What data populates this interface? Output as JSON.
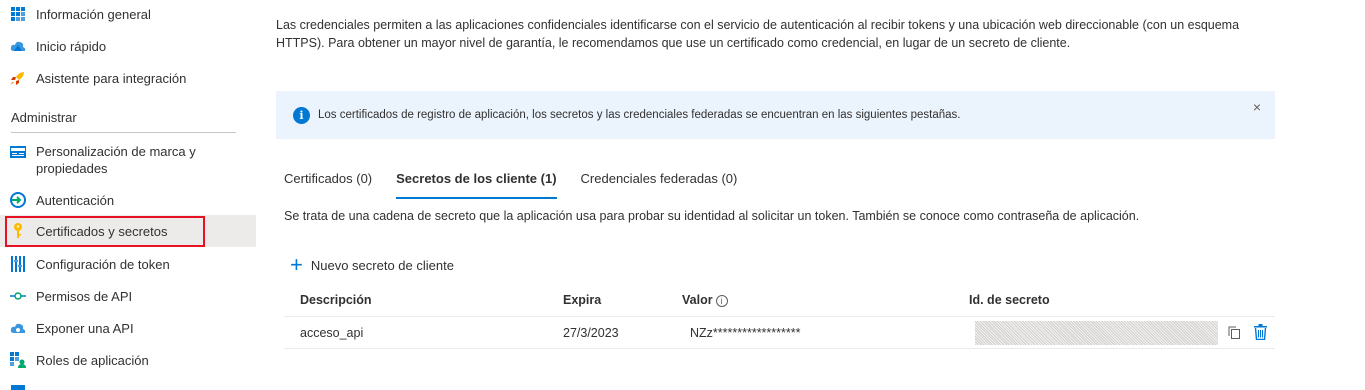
{
  "sidebar": {
    "items_top": [
      {
        "label": "Información general"
      },
      {
        "label": "Inicio rápido"
      },
      {
        "label": "Asistente para integración"
      }
    ],
    "section_title": "Administrar",
    "items_manage": [
      {
        "label": "Personalización de marca y propiedades"
      },
      {
        "label": "Autenticación"
      },
      {
        "label": "Certificados y secretos"
      },
      {
        "label": "Configuración de token"
      },
      {
        "label": "Permisos de API"
      },
      {
        "label": "Exponer una API"
      },
      {
        "label": "Roles de aplicación"
      }
    ]
  },
  "main": {
    "intro": "Las credenciales permiten a las aplicaciones confidenciales identificarse con el servicio de autenticación al recibir tokens y una ubicación web direccionable (con un esquema HTTPS). Para obtener un mayor nivel de garantía, le recomendamos que use un certificado como credencial, en lugar de un secreto de cliente.",
    "banner": {
      "text": "Los certificados de registro de aplicación, los secretos y las credenciales federadas se encuentran en las siguientes pestañas.",
      "close": "×"
    },
    "tabs": [
      {
        "label": "Certificados (0)"
      },
      {
        "label": "Secretos de los cliente (1)"
      },
      {
        "label": "Credenciales federadas (0)"
      }
    ],
    "tab_description": "Se trata de una cadena de secreto que la aplicación usa para probar su identidad al solicitar un token. También se conoce como contraseña de aplicación.",
    "new_secret_label": "Nuevo secreto de cliente",
    "table": {
      "headers": {
        "description": "Descripción",
        "expires": "Expira",
        "value": "Valor",
        "secret_id": "Id. de secreto"
      },
      "rows": [
        {
          "description": "acceso_api",
          "expires": "27/3/2023",
          "value": "NZz******************"
        }
      ]
    }
  },
  "colors": {
    "accent": "#0078d4",
    "highlight": "#e81123",
    "active_bg": "#edebe9",
    "banner_bg": "#ebf3fc"
  }
}
